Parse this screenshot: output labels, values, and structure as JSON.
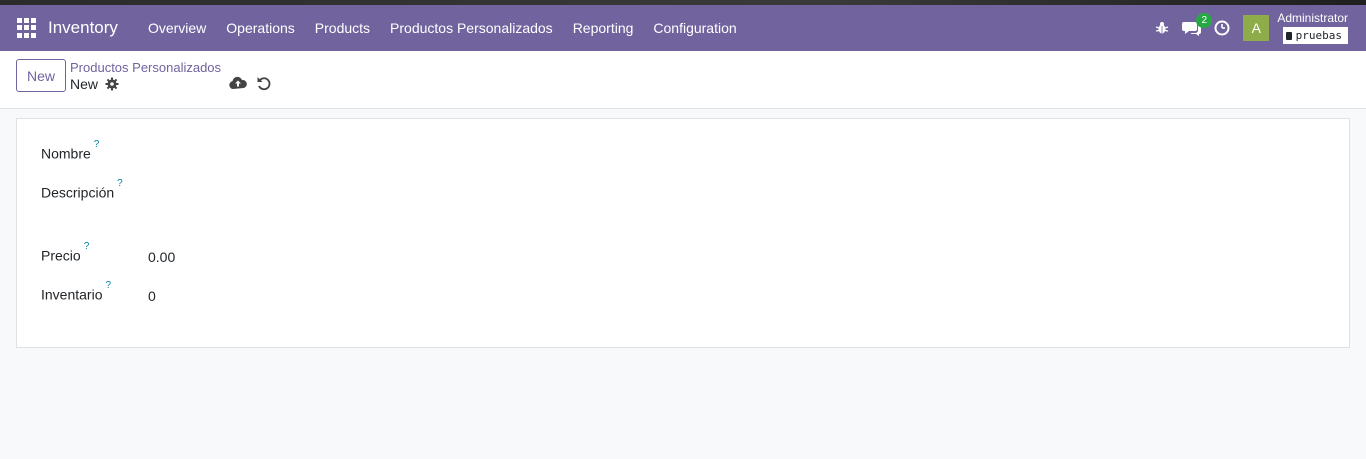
{
  "navbar": {
    "app_name": "Inventory",
    "menu": [
      "Overview",
      "Operations",
      "Products",
      "Productos Personalizados",
      "Reporting",
      "Configuration"
    ],
    "messages_count": "2",
    "user_initial": "A",
    "user_name": "Administrator",
    "database": "pruebas",
    "color": "#71639e"
  },
  "control_panel": {
    "new_label": "New",
    "breadcrumb": "Productos Personalizados",
    "record_title": "New"
  },
  "form": {
    "nombre_label": "Nombre",
    "descripcion_label": "Descripción",
    "precio_label": "Precio",
    "precio_value": "0.00",
    "inventario_label": "Inventario",
    "inventario_value": "0",
    "tooltip_mark": "?"
  }
}
